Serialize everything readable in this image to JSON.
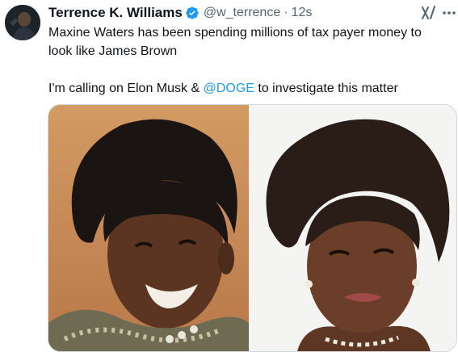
{
  "author": {
    "display_name": "Terrence K. Williams",
    "handle": "@w_terrence",
    "separator": "·",
    "timestamp": "12s"
  },
  "post": {
    "line1": "Maxine Waters has been spending millions of tax payer money to",
    "line2": "look like James Brown",
    "line3_before": "I'm calling on Elon Musk & ",
    "mention": "@DOGE",
    "line3_after": " to investigate this matter"
  },
  "icons": {
    "verified": "verified-badge-icon",
    "grok": "grok-icon",
    "more": "more-icon"
  },
  "colors": {
    "text": "#0f1419",
    "secondary": "#536471",
    "link": "#1d9bf0",
    "border": "#cfd9de"
  }
}
